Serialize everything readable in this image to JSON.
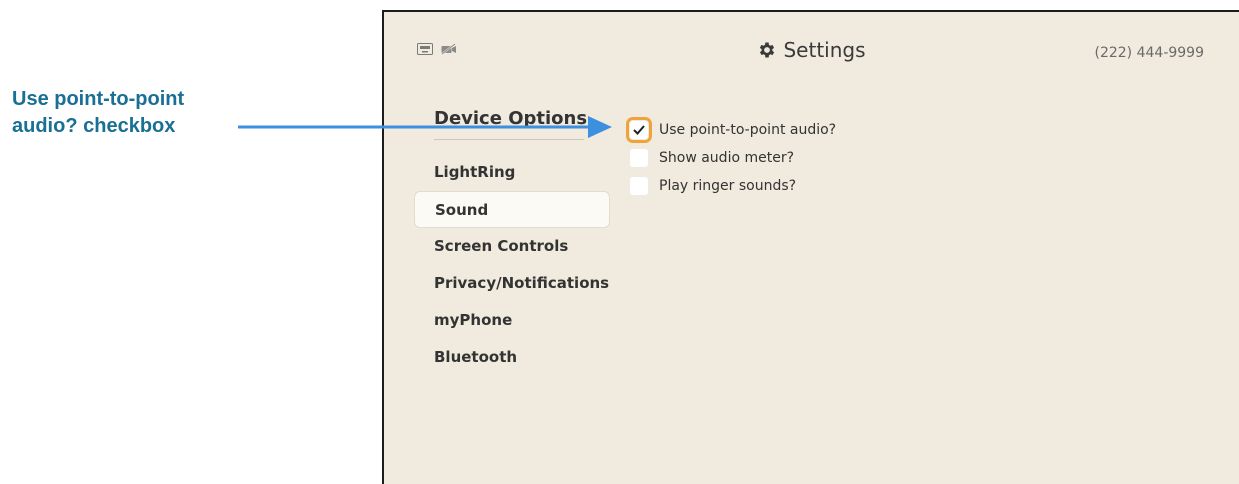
{
  "callout": {
    "line1": "Use point-to-point",
    "line2": "audio? checkbox",
    "color": "#1a6f95",
    "arrow_color": "#3d8fe0"
  },
  "header": {
    "title": "Settings",
    "title_icon": "gear-icon",
    "phone_number": "(222) 444-9999",
    "status_icons": [
      "network-icon",
      "video-off-icon"
    ]
  },
  "sidebar": {
    "section_title": "Device Options",
    "items": [
      {
        "label": "LightRing",
        "active": false
      },
      {
        "label": "Sound",
        "active": true
      },
      {
        "label": "Screen Controls",
        "active": false
      },
      {
        "label": "Privacy/Notifications",
        "active": false
      },
      {
        "label": "myPhone",
        "active": false
      },
      {
        "label": "Bluetooth",
        "active": false
      }
    ]
  },
  "options": [
    {
      "label": "Use point-to-point audio?",
      "checked": true,
      "focused": true
    },
    {
      "label": "Show audio meter?",
      "checked": false,
      "focused": false
    },
    {
      "label": "Play ringer sounds?",
      "checked": false,
      "focused": false
    }
  ],
  "colors": {
    "screen_bg": "#f0ebde",
    "focus_ring": "#f0a33a"
  }
}
